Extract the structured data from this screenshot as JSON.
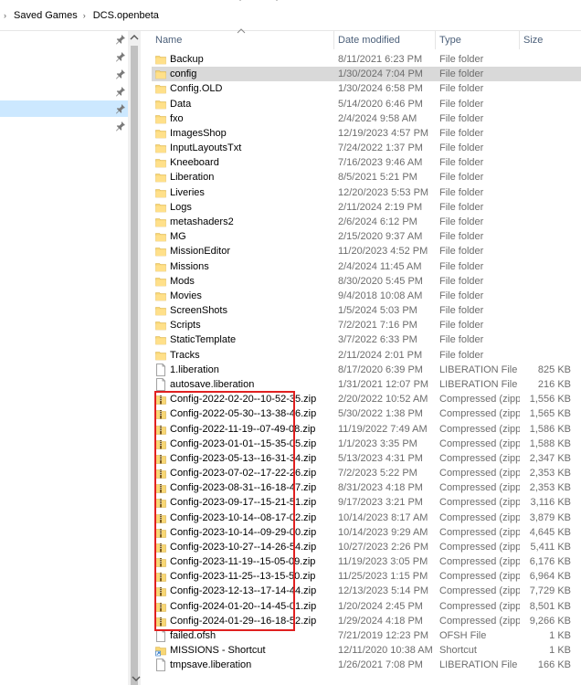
{
  "breadcrumb": {
    "items": [
      "Saved Games",
      "DCS.openbeta"
    ]
  },
  "nav": {
    "pins": 6,
    "selected_index": 4
  },
  "columns": {
    "name": "Name",
    "date": "Date modified",
    "type": "Type",
    "size": "Size"
  },
  "files": [
    {
      "name": "Backup",
      "date": "8/11/2021 6:23 PM",
      "type": "File folder",
      "size": "",
      "icon": "folder-icon"
    },
    {
      "name": "config",
      "date": "1/30/2024 7:04 PM",
      "type": "File folder",
      "size": "",
      "icon": "folder-icon"
    },
    {
      "name": "Config.OLD",
      "date": "1/30/2024 6:58 PM",
      "type": "File folder",
      "size": "",
      "icon": "folder-icon"
    },
    {
      "name": "Data",
      "date": "5/14/2020 6:46 PM",
      "type": "File folder",
      "size": "",
      "icon": "folder-icon"
    },
    {
      "name": "fxo",
      "date": "2/4/2024 9:58 AM",
      "type": "File folder",
      "size": "",
      "icon": "folder-icon"
    },
    {
      "name": "ImagesShop",
      "date": "12/19/2023 4:57 PM",
      "type": "File folder",
      "size": "",
      "icon": "folder-icon"
    },
    {
      "name": "InputLayoutsTxt",
      "date": "7/24/2022 1:37 PM",
      "type": "File folder",
      "size": "",
      "icon": "folder-icon"
    },
    {
      "name": "Kneeboard",
      "date": "7/16/2023 9:46 AM",
      "type": "File folder",
      "size": "",
      "icon": "folder-icon"
    },
    {
      "name": "Liberation",
      "date": "8/5/2021 5:21 PM",
      "type": "File folder",
      "size": "",
      "icon": "folder-icon"
    },
    {
      "name": "Liveries",
      "date": "12/20/2023 5:53 PM",
      "type": "File folder",
      "size": "",
      "icon": "folder-icon"
    },
    {
      "name": "Logs",
      "date": "2/11/2024 2:19 PM",
      "type": "File folder",
      "size": "",
      "icon": "folder-icon"
    },
    {
      "name": "metashaders2",
      "date": "2/6/2024 6:12 PM",
      "type": "File folder",
      "size": "",
      "icon": "folder-icon"
    },
    {
      "name": "MG",
      "date": "2/15/2020 9:37 AM",
      "type": "File folder",
      "size": "",
      "icon": "folder-icon"
    },
    {
      "name": "MissionEditor",
      "date": "11/20/2023 4:52 PM",
      "type": "File folder",
      "size": "",
      "icon": "folder-icon"
    },
    {
      "name": "Missions",
      "date": "2/4/2024 11:45 AM",
      "type": "File folder",
      "size": "",
      "icon": "folder-icon"
    },
    {
      "name": "Mods",
      "date": "8/30/2020 5:45 PM",
      "type": "File folder",
      "size": "",
      "icon": "folder-icon"
    },
    {
      "name": "Movies",
      "date": "9/4/2018 10:08 AM",
      "type": "File folder",
      "size": "",
      "icon": "folder-icon"
    },
    {
      "name": "ScreenShots",
      "date": "1/5/2024 5:03 PM",
      "type": "File folder",
      "size": "",
      "icon": "folder-icon"
    },
    {
      "name": "Scripts",
      "date": "7/2/2021 7:16 PM",
      "type": "File folder",
      "size": "",
      "icon": "folder-icon"
    },
    {
      "name": "StaticTemplate",
      "date": "3/7/2022 6:33 PM",
      "type": "File folder",
      "size": "",
      "icon": "folder-icon"
    },
    {
      "name": "Tracks",
      "date": "2/11/2024 2:01 PM",
      "type": "File folder",
      "size": "",
      "icon": "folder-icon"
    },
    {
      "name": "1.liberation",
      "date": "8/17/2020 6:39 PM",
      "type": "LIBERATION File",
      "size": "825 KB",
      "icon": "file-icon"
    },
    {
      "name": "autosave.liberation",
      "date": "1/31/2021 12:07 PM",
      "type": "LIBERATION File",
      "size": "216 KB",
      "icon": "file-icon"
    },
    {
      "name": "Config-2022-02-20--10-52-35.zip",
      "date": "2/20/2022 10:52 AM",
      "type": "Compressed (zipp...",
      "size": "1,556 KB",
      "icon": "zip-icon"
    },
    {
      "name": "Config-2022-05-30--13-38-46.zip",
      "date": "5/30/2022 1:38 PM",
      "type": "Compressed (zipp...",
      "size": "1,565 KB",
      "icon": "zip-icon"
    },
    {
      "name": "Config-2022-11-19--07-49-08.zip",
      "date": "11/19/2022 7:49 AM",
      "type": "Compressed (zipp...",
      "size": "1,586 KB",
      "icon": "zip-icon"
    },
    {
      "name": "Config-2023-01-01--15-35-05.zip",
      "date": "1/1/2023 3:35 PM",
      "type": "Compressed (zipp...",
      "size": "1,588 KB",
      "icon": "zip-icon"
    },
    {
      "name": "Config-2023-05-13--16-31-34.zip",
      "date": "5/13/2023 4:31 PM",
      "type": "Compressed (zipp...",
      "size": "2,347 KB",
      "icon": "zip-icon"
    },
    {
      "name": "Config-2023-07-02--17-22-26.zip",
      "date": "7/2/2023 5:22 PM",
      "type": "Compressed (zipp...",
      "size": "2,353 KB",
      "icon": "zip-icon"
    },
    {
      "name": "Config-2023-08-31--16-18-47.zip",
      "date": "8/31/2023 4:18 PM",
      "type": "Compressed (zipp...",
      "size": "2,353 KB",
      "icon": "zip-icon"
    },
    {
      "name": "Config-2023-09-17--15-21-51.zip",
      "date": "9/17/2023 3:21 PM",
      "type": "Compressed (zipp...",
      "size": "3,116 KB",
      "icon": "zip-icon"
    },
    {
      "name": "Config-2023-10-14--08-17-02.zip",
      "date": "10/14/2023 8:17 AM",
      "type": "Compressed (zipp...",
      "size": "3,879 KB",
      "icon": "zip-icon"
    },
    {
      "name": "Config-2023-10-14--09-29-00.zip",
      "date": "10/14/2023 9:29 AM",
      "type": "Compressed (zipp...",
      "size": "4,645 KB",
      "icon": "zip-icon"
    },
    {
      "name": "Config-2023-10-27--14-26-54.zip",
      "date": "10/27/2023 2:26 PM",
      "type": "Compressed (zipp...",
      "size": "5,411 KB",
      "icon": "zip-icon"
    },
    {
      "name": "Config-2023-11-19--15-05-09.zip",
      "date": "11/19/2023 3:05 PM",
      "type": "Compressed (zipp...",
      "size": "6,176 KB",
      "icon": "zip-icon"
    },
    {
      "name": "Config-2023-11-25--13-15-50.zip",
      "date": "11/25/2023 1:15 PM",
      "type": "Compressed (zipp...",
      "size": "6,964 KB",
      "icon": "zip-icon"
    },
    {
      "name": "Config-2023-12-13--17-14-44.zip",
      "date": "12/13/2023 5:14 PM",
      "type": "Compressed (zipp...",
      "size": "7,729 KB",
      "icon": "zip-icon"
    },
    {
      "name": "Config-2024-01-20--14-45-01.zip",
      "date": "1/20/2024 2:45 PM",
      "type": "Compressed (zipp...",
      "size": "8,501 KB",
      "icon": "zip-icon"
    },
    {
      "name": "Config-2024-01-29--16-18-52.zip",
      "date": "1/29/2024 4:18 PM",
      "type": "Compressed (zipp...",
      "size": "9,266 KB",
      "icon": "zip-icon"
    },
    {
      "name": "failed.ofsh",
      "date": "7/21/2019 12:23 PM",
      "type": "OFSH File",
      "size": "1 KB",
      "icon": "file-icon"
    },
    {
      "name": "MISSIONS - Shortcut",
      "date": "12/11/2020 10:38 AM",
      "type": "Shortcut",
      "size": "1 KB",
      "icon": "shortcut-icon"
    },
    {
      "name": "tmpsave.liberation",
      "date": "1/26/2021 7:08 PM",
      "type": "LIBERATION File",
      "size": "166 KB",
      "icon": "file-icon"
    }
  ],
  "selected_file_index": 1,
  "highlight_color": "#e02020"
}
